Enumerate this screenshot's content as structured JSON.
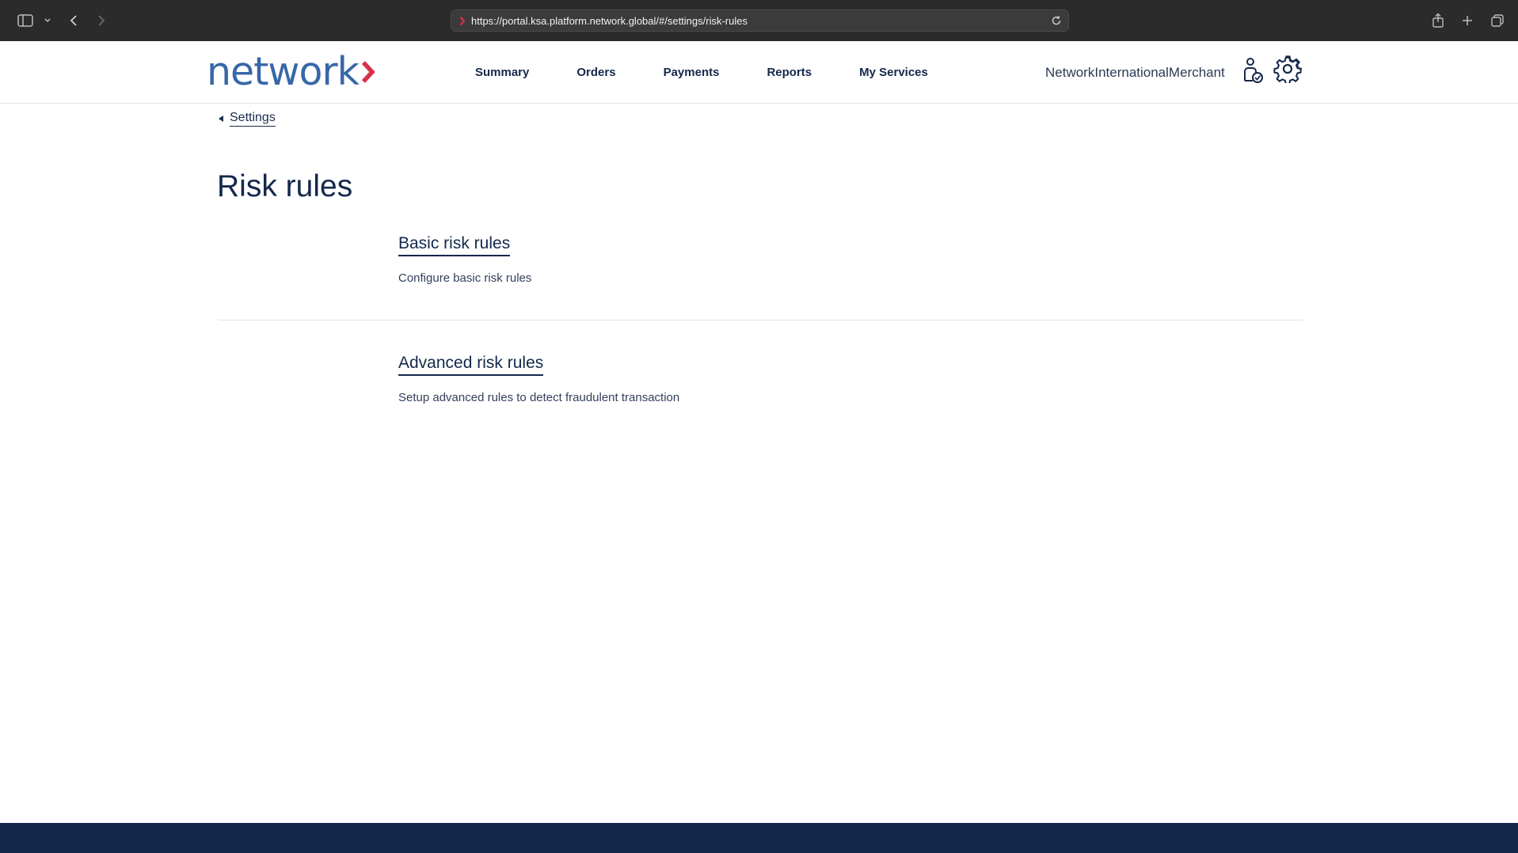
{
  "browser": {
    "url": "https://portal.ksa.platform.network.global/#/settings/risk-rules",
    "icons": [
      "sidebar-icon",
      "chevron-down-icon",
      "back-arrow-icon",
      "forward-arrow-icon",
      "reload-icon",
      "share-icon",
      "plus-icon",
      "tabs-icon"
    ]
  },
  "header": {
    "logo_text": "network",
    "nav": [
      "Summary",
      "Orders",
      "Payments",
      "Reports",
      "My Services"
    ],
    "merchant_name": "NetworkInternationalMerchant"
  },
  "breadcrumb": {
    "label": "Settings"
  },
  "page": {
    "title": "Risk rules"
  },
  "sections": [
    {
      "title": "Basic risk rules",
      "description": "Configure basic risk rules"
    },
    {
      "title": "Advanced risk rules",
      "description": "Setup advanced rules to detect fraudulent transaction"
    }
  ],
  "colors": {
    "brand_blue": "#3767a8",
    "brand_red": "#d6314a",
    "navy": "#14284b",
    "chrome": "#2b2b2b"
  }
}
